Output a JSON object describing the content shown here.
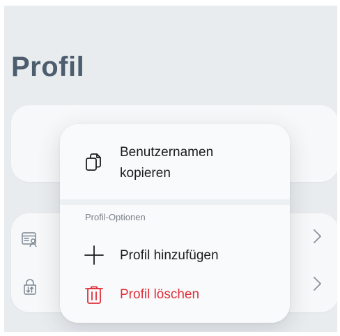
{
  "header": {
    "title": "Profil"
  },
  "context_menu": {
    "copy_username_line1": "Benutzernamen",
    "copy_username_line2": "kopieren",
    "section_label": "Profil-Optionen",
    "add_profile": "Profil hinzufügen",
    "delete_profile": "Profil löschen"
  },
  "icons": {
    "copy": "copy-icon",
    "plus": "plus-icon",
    "trash": "trash-icon",
    "profile_card": "profile-card-icon",
    "lock_import": "lock-import-icon",
    "chevron": "chevron-right-icon"
  },
  "colors": {
    "title": "#4d5d6e",
    "destructive": "#e0303a",
    "background": "#e9ecef",
    "card": "#f7f8f9"
  }
}
